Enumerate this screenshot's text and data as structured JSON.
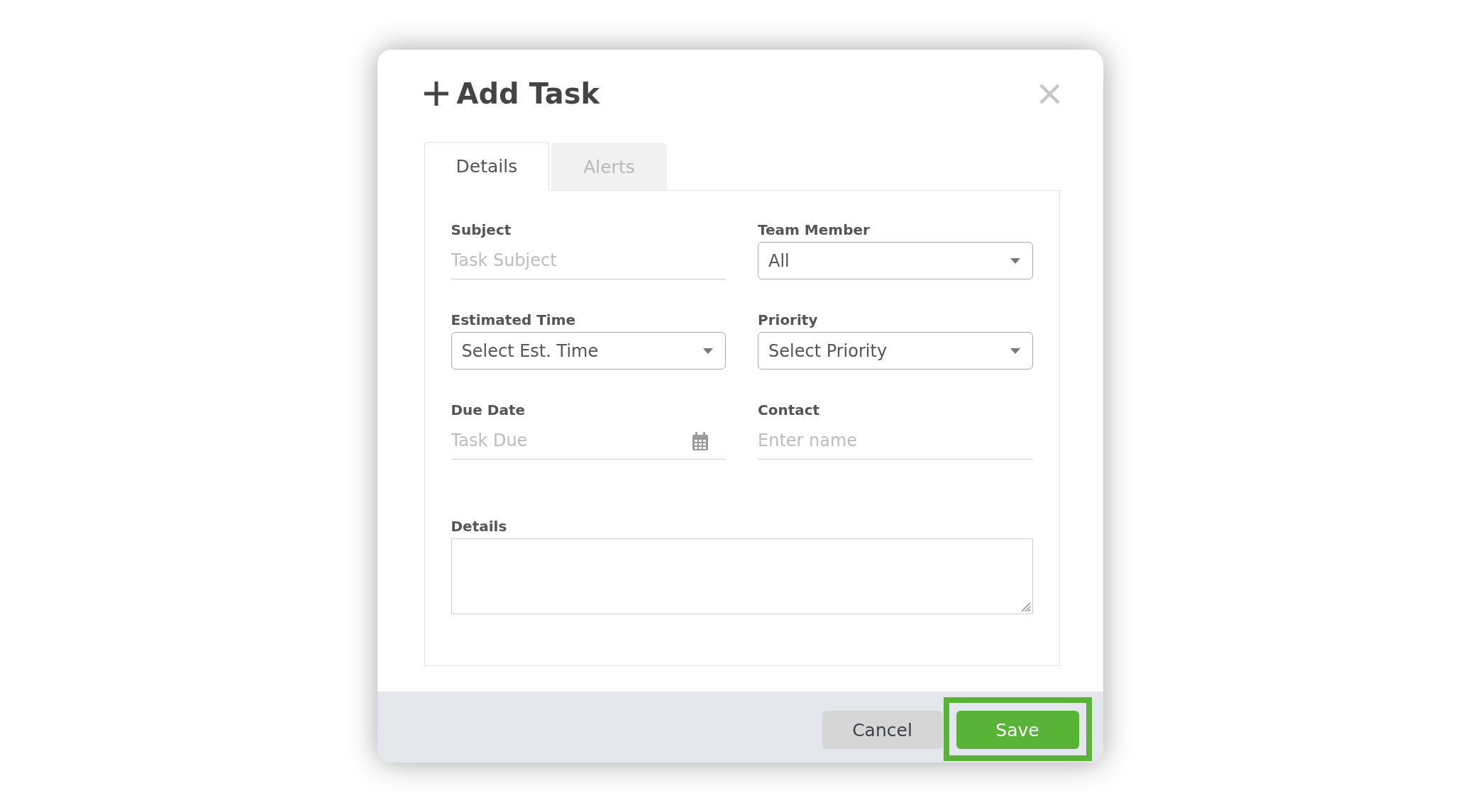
{
  "dialog": {
    "title": "Add Task",
    "tabs": [
      {
        "label": "Details",
        "selected": true
      },
      {
        "label": "Alerts",
        "selected": false
      }
    ],
    "fields": [
      {
        "kind": "text",
        "label": "Subject",
        "placeholder": "Task Subject"
      },
      {
        "kind": "select",
        "label": "Team Member",
        "value": "All"
      },
      {
        "kind": "select",
        "label": "Estimated Time",
        "value": "Select Est. Time"
      },
      {
        "kind": "select",
        "label": "Priority",
        "value": "Select Priority"
      },
      {
        "kind": "date",
        "label": "Due Date",
        "placeholder": "Task Due"
      },
      {
        "kind": "text",
        "label": "Contact",
        "placeholder": "Enter name"
      },
      {
        "kind": "textarea",
        "label": "Details"
      }
    ],
    "buttons": [
      {
        "label": "Cancel",
        "kind": "secondary",
        "highlighted": false
      },
      {
        "label": "Save",
        "kind": "primary",
        "highlighted": true
      }
    ]
  }
}
